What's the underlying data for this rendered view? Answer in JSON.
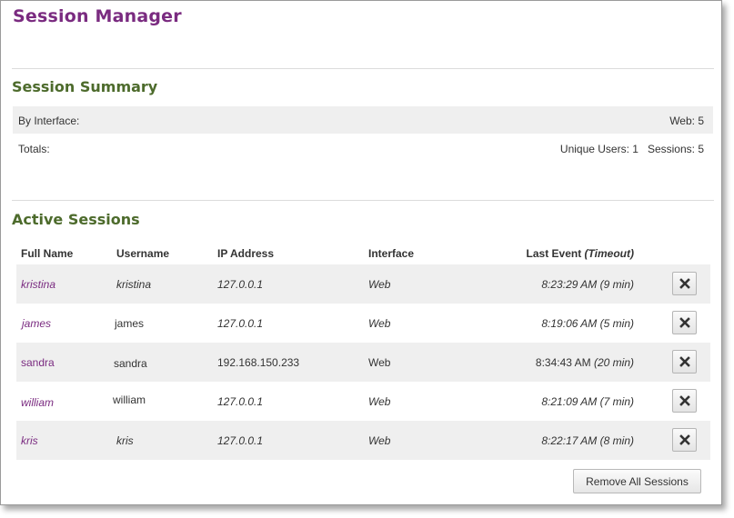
{
  "page": {
    "title": "Session Manager"
  },
  "summary": {
    "title": "Session Summary",
    "by_interface_label": "By Interface:",
    "by_interface_value": "Web: 5",
    "totals_label": "Totals:",
    "unique_users": "Unique Users: 1",
    "sessions": "Sessions: 5"
  },
  "active": {
    "title": "Active Sessions",
    "columns": {
      "full_name": "Full Name",
      "username": "Username",
      "ip": "IP Address",
      "interface": "Interface",
      "last_event": "Last Event",
      "timeout": "(Timeout)"
    },
    "rows": [
      {
        "full_name": "kristina",
        "username": "kristina",
        "ip": "127.0.0.1",
        "interface": "Web",
        "time": "8:23:29 AM",
        "timeout": "(9 min)"
      },
      {
        "full_name": "james",
        "username": "james",
        "ip": "127.0.0.1",
        "interface": "Web",
        "time": "8:19:06 AM",
        "timeout": "(5 min)"
      },
      {
        "full_name": "sandra",
        "username": "sandra",
        "ip": "192.168.150.233",
        "interface": "Web",
        "time": "8:34:43 AM",
        "timeout": "(20 min)"
      },
      {
        "full_name": "william",
        "username": "william",
        "ip": "127.0.0.1",
        "interface": "Web",
        "time": "8:21:09 AM",
        "timeout": "(7 min)"
      },
      {
        "full_name": "kris",
        "username": "kris",
        "ip": "127.0.0.1",
        "interface": "Web",
        "time": "8:22:17 AM",
        "timeout": "(8 min)"
      }
    ],
    "remove_all_label": "Remove All Sessions"
  },
  "icons": {
    "remove": "close-icon"
  },
  "colors": {
    "title": "#7a2b80",
    "section": "#4d6b2c",
    "link": "#7a2b80",
    "shade": "#efefef"
  }
}
